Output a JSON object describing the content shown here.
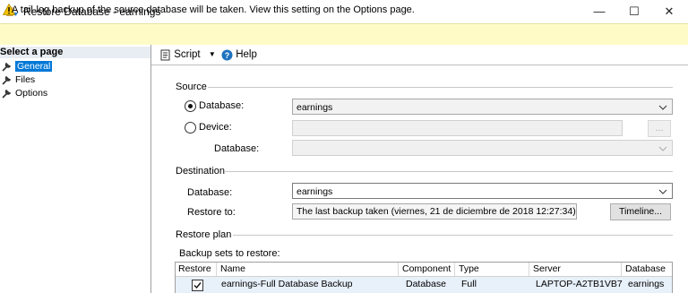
{
  "window": {
    "title": "Restore Database - earnings",
    "minimize_glyph": "—",
    "maximize_glyph": "☐",
    "close_glyph": "✕"
  },
  "warning": {
    "text": "A tail-log backup of the source database will be taken. View this setting on the Options page.",
    "icon": "warning-icon"
  },
  "left_pane": {
    "header": "Select a page",
    "items": [
      {
        "label": "General",
        "icon": "wrench-icon",
        "selected": true
      },
      {
        "label": "Files",
        "icon": "wrench-icon",
        "selected": false
      },
      {
        "label": "Options",
        "icon": "wrench-icon",
        "selected": false
      }
    ]
  },
  "toolbar": {
    "script_label": "Script",
    "help_label": "Help"
  },
  "source": {
    "section_label": "Source",
    "database_radio_label": "Database:",
    "database_value": "earnings",
    "device_radio_label": "Device:",
    "device_value": "",
    "browse_label": "...",
    "device_database_label": "Database:",
    "device_database_value": ""
  },
  "destination": {
    "section_label": "Destination",
    "database_label": "Database:",
    "database_value": "earnings",
    "restore_to_label": "Restore to:",
    "restore_to_value": "The last backup taken (viernes, 21 de diciembre de 2018 12:27:34)",
    "timeline_label": "Timeline..."
  },
  "restore_plan": {
    "section_label": "Restore plan",
    "backup_sets_label": "Backup sets to restore:",
    "columns": [
      "Restore",
      "Name",
      "Component",
      "Type",
      "Server",
      "Database"
    ],
    "rows": [
      {
        "restore": true,
        "name": "earnings-Full Database Backup",
        "component": "Database",
        "type": "Full",
        "server": "LAPTOP-A2TB1VB7",
        "database": "earnings"
      }
    ]
  },
  "colors": {
    "warning_bg": "#fffbc7",
    "selection": "#0078d7",
    "help_icon": "#1e73be"
  }
}
